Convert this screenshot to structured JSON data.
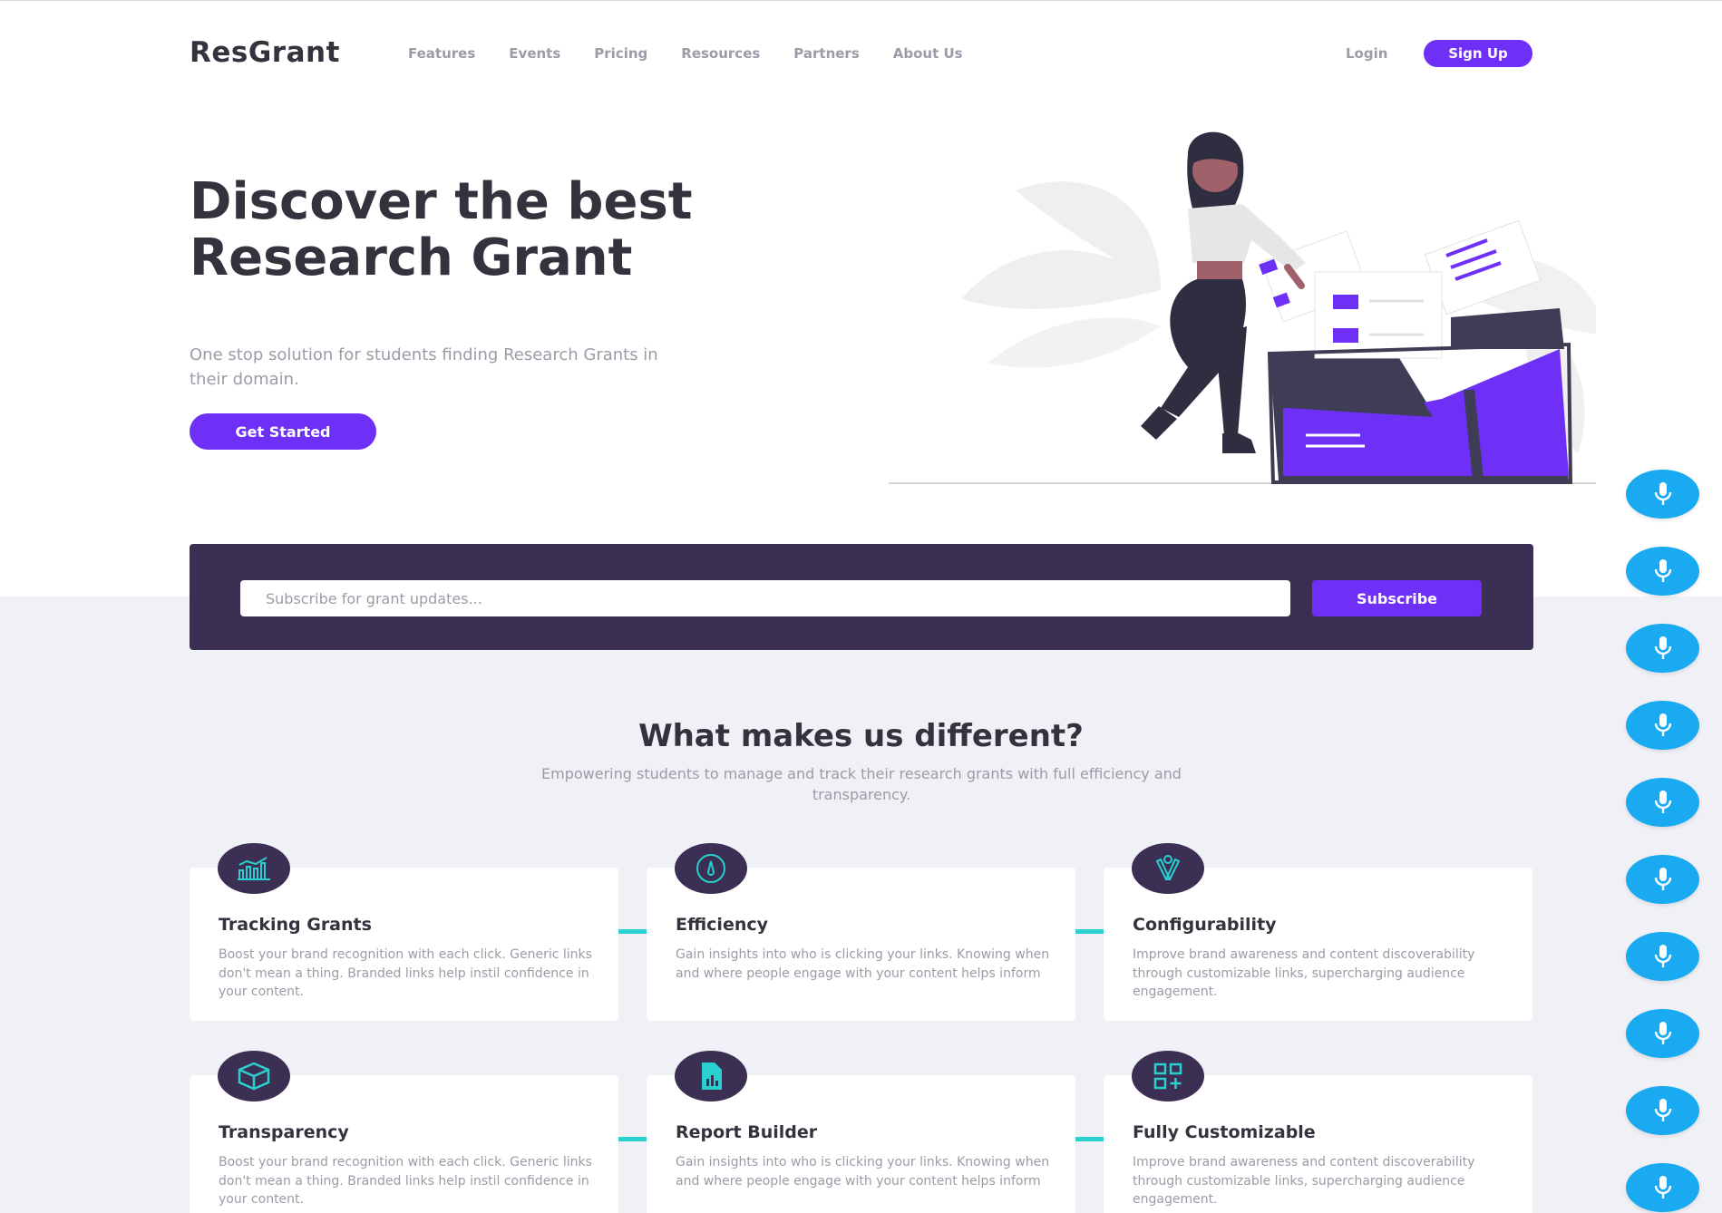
{
  "nav": {
    "logo": "ResGrant",
    "links": [
      "Features",
      "Events",
      "Pricing",
      "Resources",
      "Partners",
      "About Us"
    ],
    "login": "Login",
    "signup": "Sign Up"
  },
  "hero": {
    "title": "Discover the best Research Grant",
    "subtitle": "One stop solution for students finding Research Grants in their domain.",
    "cta": "Get Started"
  },
  "subscribe": {
    "placeholder": "Subscribe for grant updates...",
    "button": "Subscribe"
  },
  "features": {
    "title": "What makes us different?",
    "subtitle": "Empowering students to manage and track their research grants with full efficiency and transparency.",
    "cards": [
      {
        "title": "Tracking Grants",
        "text": "Boost your brand recognition with each click. Generic links don't mean a thing. Branded links help instil confidence in your content.",
        "icon": "chart-icon"
      },
      {
        "title": "Efficiency",
        "text": "Gain insights into who is clicking your links. Knowing when and where people engage with your content helps inform",
        "icon": "gauge-icon"
      },
      {
        "title": "Configurability",
        "text": "Improve brand awareness and content discoverability through customizable links, supercharging audience engagement.",
        "icon": "tools-icon"
      },
      {
        "title": "Transparency",
        "text": "Boost your brand recognition with each click. Generic links don't mean a thing. Branded links help instil confidence in your content.",
        "icon": "cube-icon"
      },
      {
        "title": "Report Builder",
        "text": "Gain insights into who is clicking your links. Knowing when and where people engage with your content helps inform",
        "icon": "report-icon"
      },
      {
        "title": "Fully Customizable",
        "text": "Improve brand awareness and content discoverability through customizable links, supercharging audience engagement.",
        "icon": "grid-add-icon"
      }
    ]
  },
  "colors": {
    "accent": "#6e2ff6",
    "dark": "#3b3053",
    "cyan": "#2acfcf",
    "mic": "#19aaf2"
  },
  "mic_buttons": [
    "microphone-icon",
    "microphone-icon",
    "microphone-icon",
    "microphone-icon",
    "microphone-icon",
    "microphone-icon",
    "microphone-icon",
    "microphone-icon",
    "microphone-icon",
    "microphone-icon"
  ]
}
